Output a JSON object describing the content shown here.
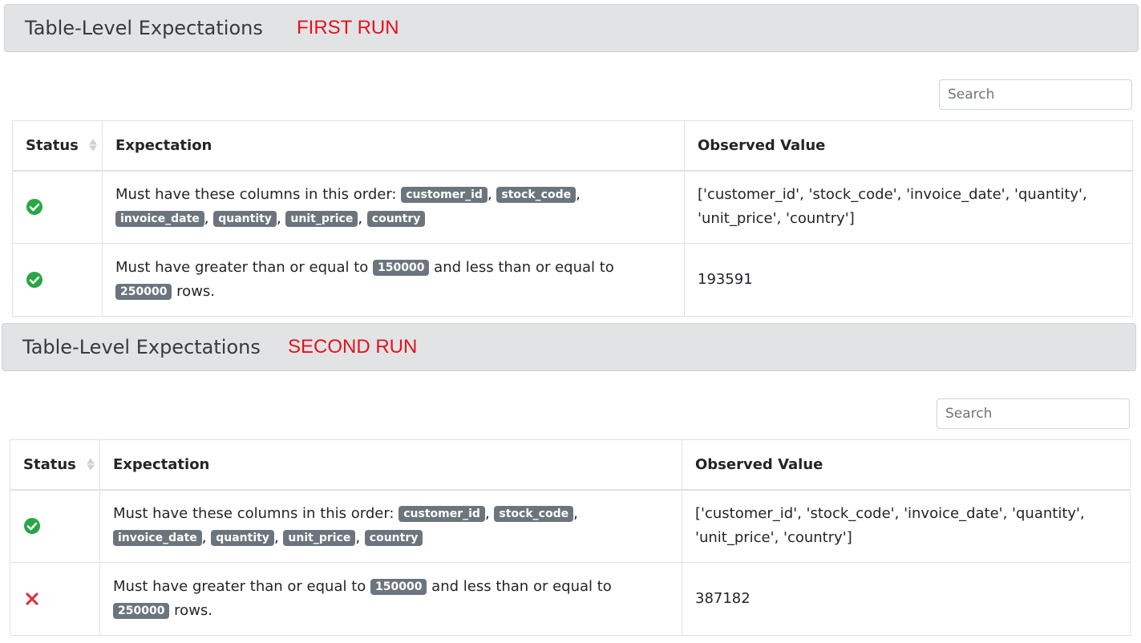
{
  "runs": [
    {
      "header": "Table-Level Expectations",
      "run_label": "FIRST RUN",
      "search_placeholder": "Search",
      "columns": {
        "status": "Status",
        "expectation": "Expectation",
        "observed": "Observed Value"
      },
      "rows": [
        {
          "status": "success",
          "expectation": {
            "prefix": "Must have these columns in this order: ",
            "badges": [
              "customer_id",
              "stock_code",
              "invoice_date",
              "quantity",
              "unit_price",
              "country"
            ]
          },
          "observed": "['customer_id', 'stock_code', 'invoice_date', 'quantity', 'unit_price', 'country']"
        },
        {
          "status": "success",
          "expectation": {
            "p1": "Must have greater than or equal to ",
            "min": "150000",
            "p2": " and less than or equal to ",
            "max": "250000",
            "p3": " rows."
          },
          "observed": "193591"
        }
      ]
    },
    {
      "header": "Table-Level Expectations",
      "run_label": "SECOND RUN",
      "search_placeholder": "Search",
      "columns": {
        "status": "Status",
        "expectation": "Expectation",
        "observed": "Observed Value"
      },
      "rows": [
        {
          "status": "success",
          "expectation": {
            "prefix": "Must have these columns in this order: ",
            "badges": [
              "customer_id",
              "stock_code",
              "invoice_date",
              "quantity",
              "unit_price",
              "country"
            ]
          },
          "observed": "['customer_id', 'stock_code', 'invoice_date', 'quantity', 'unit_price', 'country']"
        },
        {
          "status": "failure",
          "expectation": {
            "p1": "Must have greater than or equal to ",
            "min": "150000",
            "p2": " and less than or equal to ",
            "max": "250000",
            "p3": " rows."
          },
          "observed": "387182"
        }
      ]
    }
  ],
  "colors": {
    "success": "#28a745",
    "failure": "#dc3545",
    "badge": "#6c757d",
    "run_label": "#e0141e",
    "header_bg": "#e2e3e5"
  },
  "icons": {
    "success": "check-circle-icon",
    "failure": "x-mark-icon",
    "sort": "sort-arrows-icon"
  }
}
